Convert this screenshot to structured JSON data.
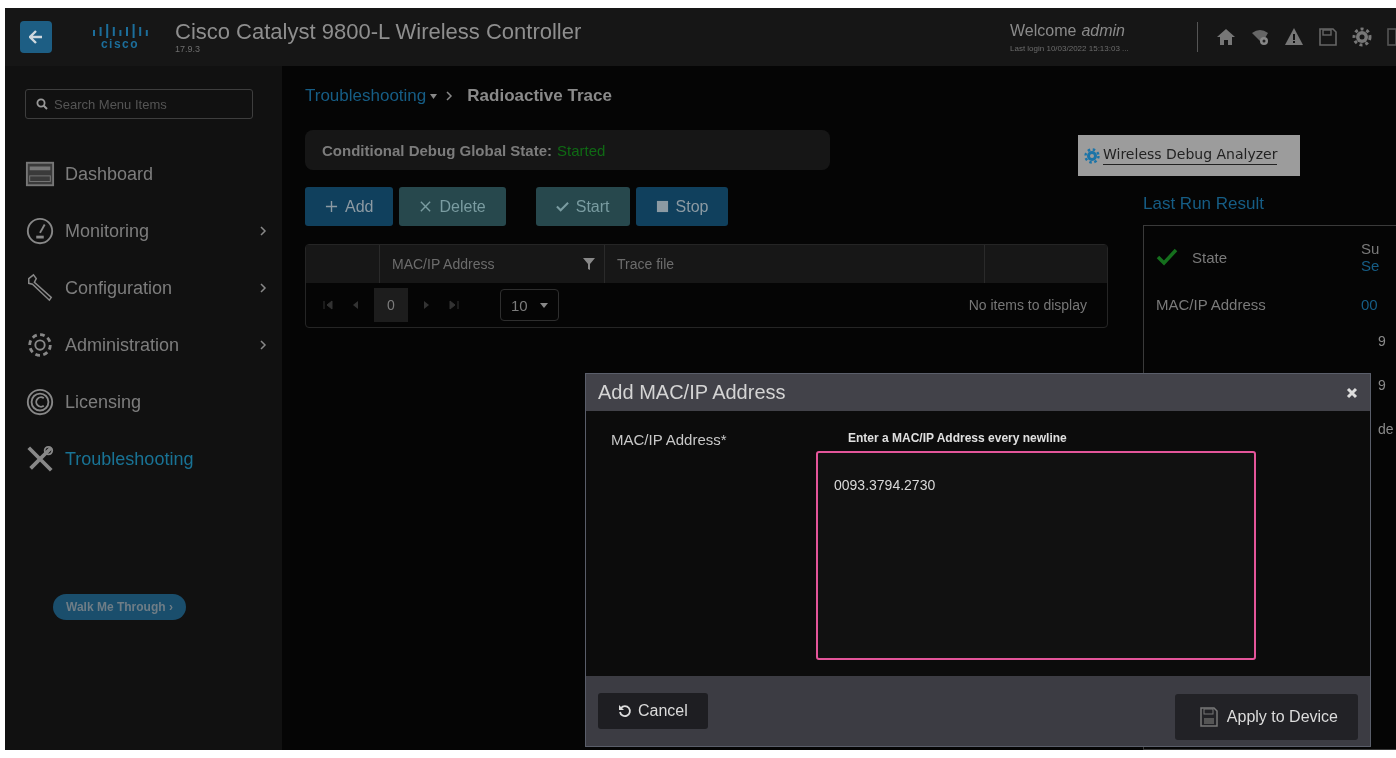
{
  "header": {
    "product": "Cisco Catalyst 9800-L Wireless Controller",
    "version": "17.9.3",
    "logo": "cisco",
    "welcome": "Welcome",
    "user": "admin",
    "last_login": "Last login 10/03/2022 15:13:03 ..."
  },
  "sidebar": {
    "search": {
      "placeholder": "Search Menu Items"
    },
    "items": [
      {
        "label": "Dashboard",
        "expandable": false,
        "selected": false
      },
      {
        "label": "Monitoring",
        "expandable": true,
        "selected": false
      },
      {
        "label": "Configuration",
        "expandable": true,
        "selected": false
      },
      {
        "label": "Administration",
        "expandable": true,
        "selected": false
      },
      {
        "label": "Licensing",
        "expandable": false,
        "selected": false
      },
      {
        "label": "Troubleshooting",
        "expandable": false,
        "selected": true
      }
    ],
    "walk_me": "Walk Me Through ›"
  },
  "breadcrumb": {
    "parent": "Troubleshooting",
    "current": "Radioactive Trace"
  },
  "debug_state": {
    "label": "Conditional Debug Global State:",
    "value": "Started"
  },
  "toolbar": [
    {
      "label": "Add",
      "disabled": false
    },
    {
      "label": "Delete",
      "disabled": true
    },
    {
      "label": "Start",
      "disabled": true
    },
    {
      "label": "Stop",
      "disabled": false
    }
  ],
  "table": {
    "columns": [
      "MAC/IP Address",
      "Trace file"
    ],
    "page": "0",
    "page_size": "10",
    "empty": "No items to display"
  },
  "analyzer": {
    "label": "Wireless Debug Analyzer"
  },
  "last_run": {
    "title": "Last Run Result",
    "state_label": "State",
    "state_value": "Su",
    "state_link": "Se",
    "mac_label": "MAC/IP Address",
    "mac_value": "00",
    "hidden_rows": [
      "9",
      "9",
      "de"
    ]
  },
  "modal": {
    "title": "Add MAC/IP Address",
    "field_label": "MAC/IP Address*",
    "hint": "Enter a MAC/IP Address every newline",
    "value": "0093.3794.2730",
    "cancel": "Cancel",
    "apply": "Apply to Device"
  }
}
